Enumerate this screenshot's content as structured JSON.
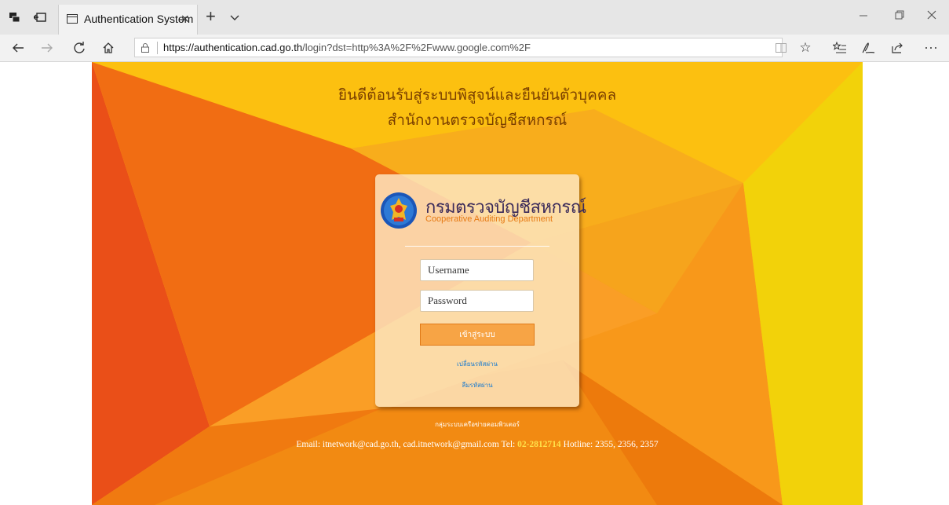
{
  "browser": {
    "tab_title": "Authentication System",
    "tab_close": "×",
    "new_tab": "+",
    "url_host": "https://authentication.cad.go.th",
    "url_path": "/login?dst=http%3A%2F%2Fwww.google.com%2F"
  },
  "page": {
    "heading_line1": "ยินดีต้อนรับสู่ระบบพิสูจน์และยืนยันตัวบุคคล",
    "heading_line2": "สำนักงานตรวจบัญชีสหกรณ์",
    "org_name_th": "กรมตรวจบัญชีสหกรณ์",
    "org_name_en": "Cooperative Auditing Department",
    "username_placeholder": "Username",
    "password_placeholder": "Password",
    "login_button": "เข้าสู่ระบบ",
    "change_password_link": "เปลี่ยนรหัสผ่าน",
    "forgot_password_link": "ลืมรหัสผ่าน",
    "footer_group": "กลุ่มระบบเครือข่ายคอมพิวเตอร์",
    "footer_email": "Email: itnetwork@cad.go.th, cad.itnetwork@gmail.com Tel:",
    "footer_tel": "02-2812714",
    "footer_hotline": "Hotline: 2355, 2356, 2357"
  },
  "colors": {
    "accent_orange": "#f7a445",
    "background_yellow": "#fcc515",
    "background_red": "#e8501a"
  },
  "icons": [
    "tab-actions-icon",
    "tabs-aside-icon",
    "page-icon",
    "tab-list-chevron-icon",
    "minimize-icon",
    "restore-icon",
    "close-window-icon",
    "back-icon",
    "forward-icon",
    "refresh-icon",
    "home-icon",
    "lock-icon",
    "reading-view-icon",
    "favorite-star-icon",
    "favorites-list-icon",
    "pen-icon",
    "share-icon",
    "more-icon",
    "org-logo-icon"
  ]
}
